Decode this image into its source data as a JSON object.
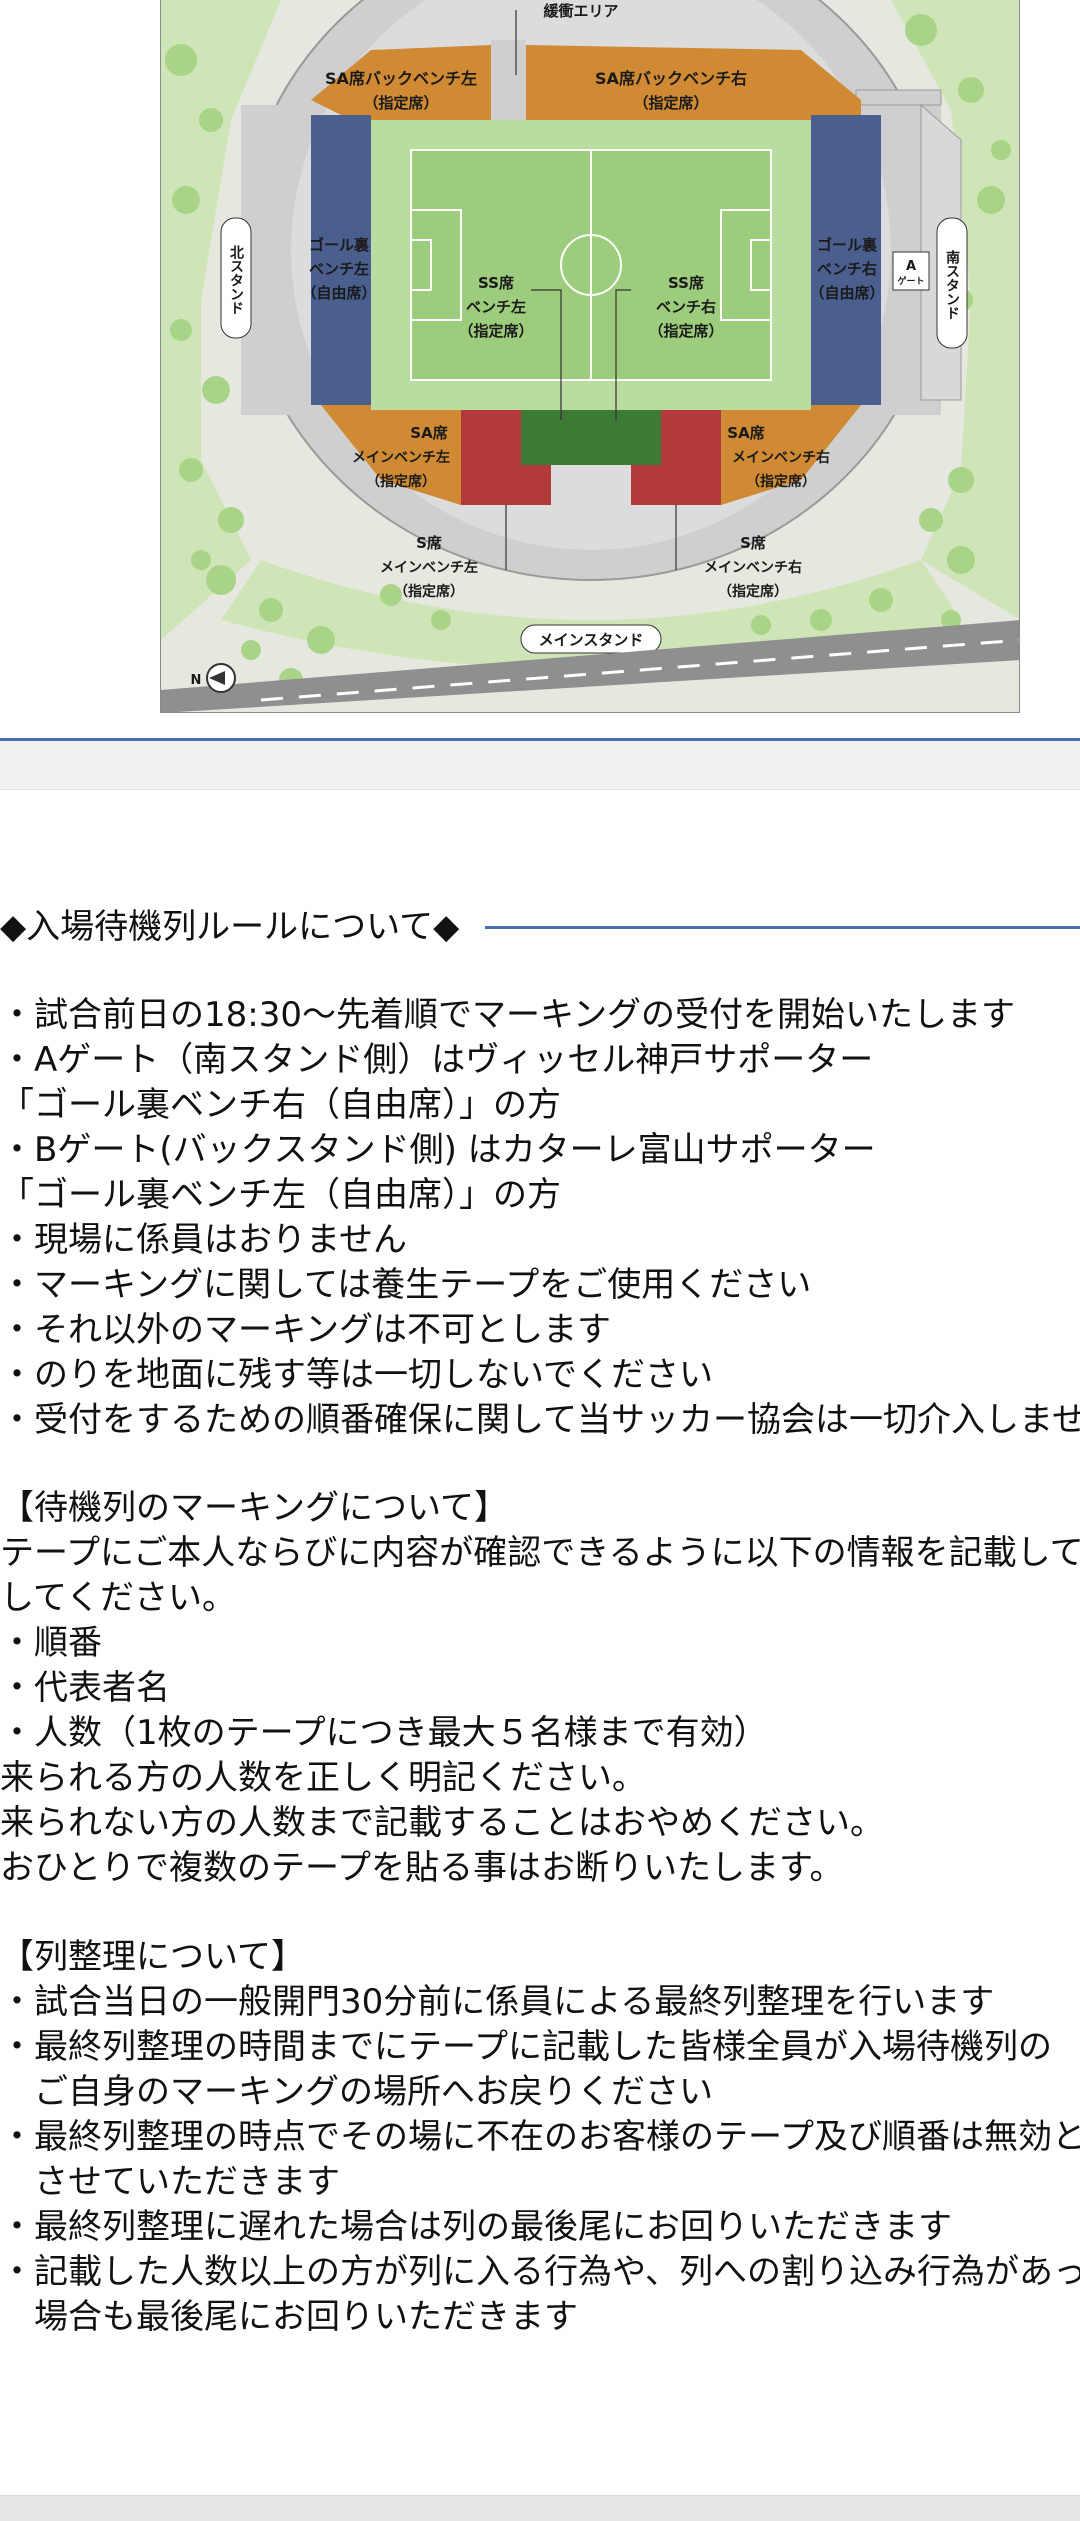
{
  "map": {
    "labels": {
      "buffer_area": "緩衝エリア",
      "sa_back_left_1": "SA席バックベンチ左",
      "sa_back_left_2": "（指定席）",
      "sa_back_right_1": "SA席バックベンチ右",
      "sa_back_right_2": "（指定席）",
      "goal_left_1": "ゴール裏",
      "goal_left_2": "ベンチ左",
      "goal_left_3": "（自由席）",
      "goal_right_1": "ゴール裏",
      "goal_right_2": "ベンチ右",
      "goal_right_3": "（自由席）",
      "north_stand": "北スタンド",
      "south_stand": "南スタンド",
      "gate_a_1": "A",
      "gate_a_2": "ゲート",
      "ss_left_1": "SS席",
      "ss_left_2": "ベンチ左",
      "ss_left_3": "（指定席）",
      "ss_right_1": "SS席",
      "ss_right_2": "ベンチ右",
      "ss_right_3": "（指定席）",
      "sa_main_left_1": "SA席",
      "sa_main_left_2": "メインベンチ左",
      "sa_main_left_3": "（指定席）",
      "sa_main_right_1": "SA席",
      "sa_main_right_2": "メインベンチ右",
      "sa_main_right_3": "（指定席）",
      "s_left_1": "S席",
      "s_left_2": "メインベンチ左",
      "s_left_3": "（指定席）",
      "s_right_1": "S席",
      "s_right_2": "メインベンチ右",
      "s_right_3": "（指定席）",
      "main_stand": "メインスタンド",
      "north_marker": "N"
    },
    "colors": {
      "sa_orange": "#cf8a33",
      "goal_blue": "#4a5f8e",
      "s_red": "#b23a3a",
      "ss_green": "#3d7a36",
      "pitch": "#9ccc7c",
      "concourse": "#cfcfcf",
      "outer_grass": "#cfe5b8",
      "trees": "#a9d487"
    }
  },
  "section1": {
    "heading": "◆入場待機列ルールについて◆",
    "lines": [
      "・試合前日の18:30～先着順でマーキングの受付を開始いたします",
      "・Aゲート（南スタンド側）はヴィッセル神戸サポーター",
      "「ゴール裏ベンチ右（自由席）」の方",
      "・Bゲート(バックスタンド側) はカターレ富山サポーター",
      "「ゴール裏ベンチ左（自由席）」の方",
      "・現場に係員はおりません",
      "・マーキングに関しては養生テープをご使用ください",
      "・それ以外のマーキングは不可とします",
      "・のりを地面に残す等は一切しないでください",
      "・受付をするための順番確保に関して当サッカー協会は一切介入しません"
    ]
  },
  "section2": {
    "heading": "【待機列のマーキングについて】",
    "lines": [
      "テープにご本人ならびに内容が確認できるように以下の情報を記載して設置",
      "してください。",
      "・順番",
      "・代表者名",
      "・人数（1枚のテープにつき最大５名様まで有効）",
      "来られる方の人数を正しく明記ください。",
      "来られない方の人数まで記載することはおやめください。",
      "おひとりで複数のテープを貼る事はお断りいたします。"
    ]
  },
  "section3": {
    "heading": "【列整理について】",
    "lines": [
      "・試合当日の一般開門30分前に係員による最終列整理を行います",
      "・最終列整理の時間までにテープに記載した皆様全員が入場待機列の",
      "　ご自身のマーキングの場所へお戻りください",
      "・最終列整理の時点でその場に不在のお客様のテープ及び順番は無効と",
      "　させていただきます",
      "・最終列整理に遅れた場合は列の最後尾にお回りいただきます",
      "・記載した人数以上の方が列に入る行為や、列への割り込み行為があった",
      "　場合も最後尾にお回りいただきます"
    ]
  }
}
